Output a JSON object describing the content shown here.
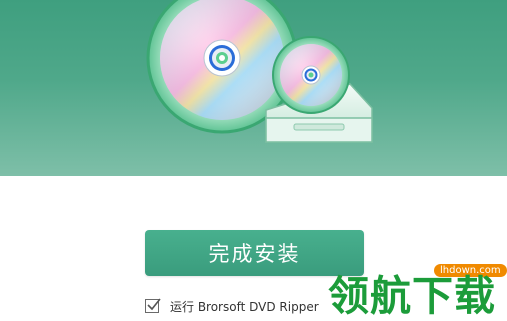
{
  "installer": {
    "finish_button_label": "完成安装",
    "run_checkbox_label": "运行 Brorsoft DVD Ripper",
    "run_checkbox_checked": true
  },
  "watermark": {
    "url": "lhdown.com",
    "text": "领航下载"
  },
  "colors": {
    "hero_top": "#3f9f7f",
    "hero_bottom": "#7ebfa8",
    "button": "#3fa585",
    "watermark_green": "#1c9c3a",
    "watermark_orange": "#f08a00"
  },
  "icons": {
    "hero": "dvd-discs-drive-illustration",
    "checkbox": "checkmark-icon"
  }
}
